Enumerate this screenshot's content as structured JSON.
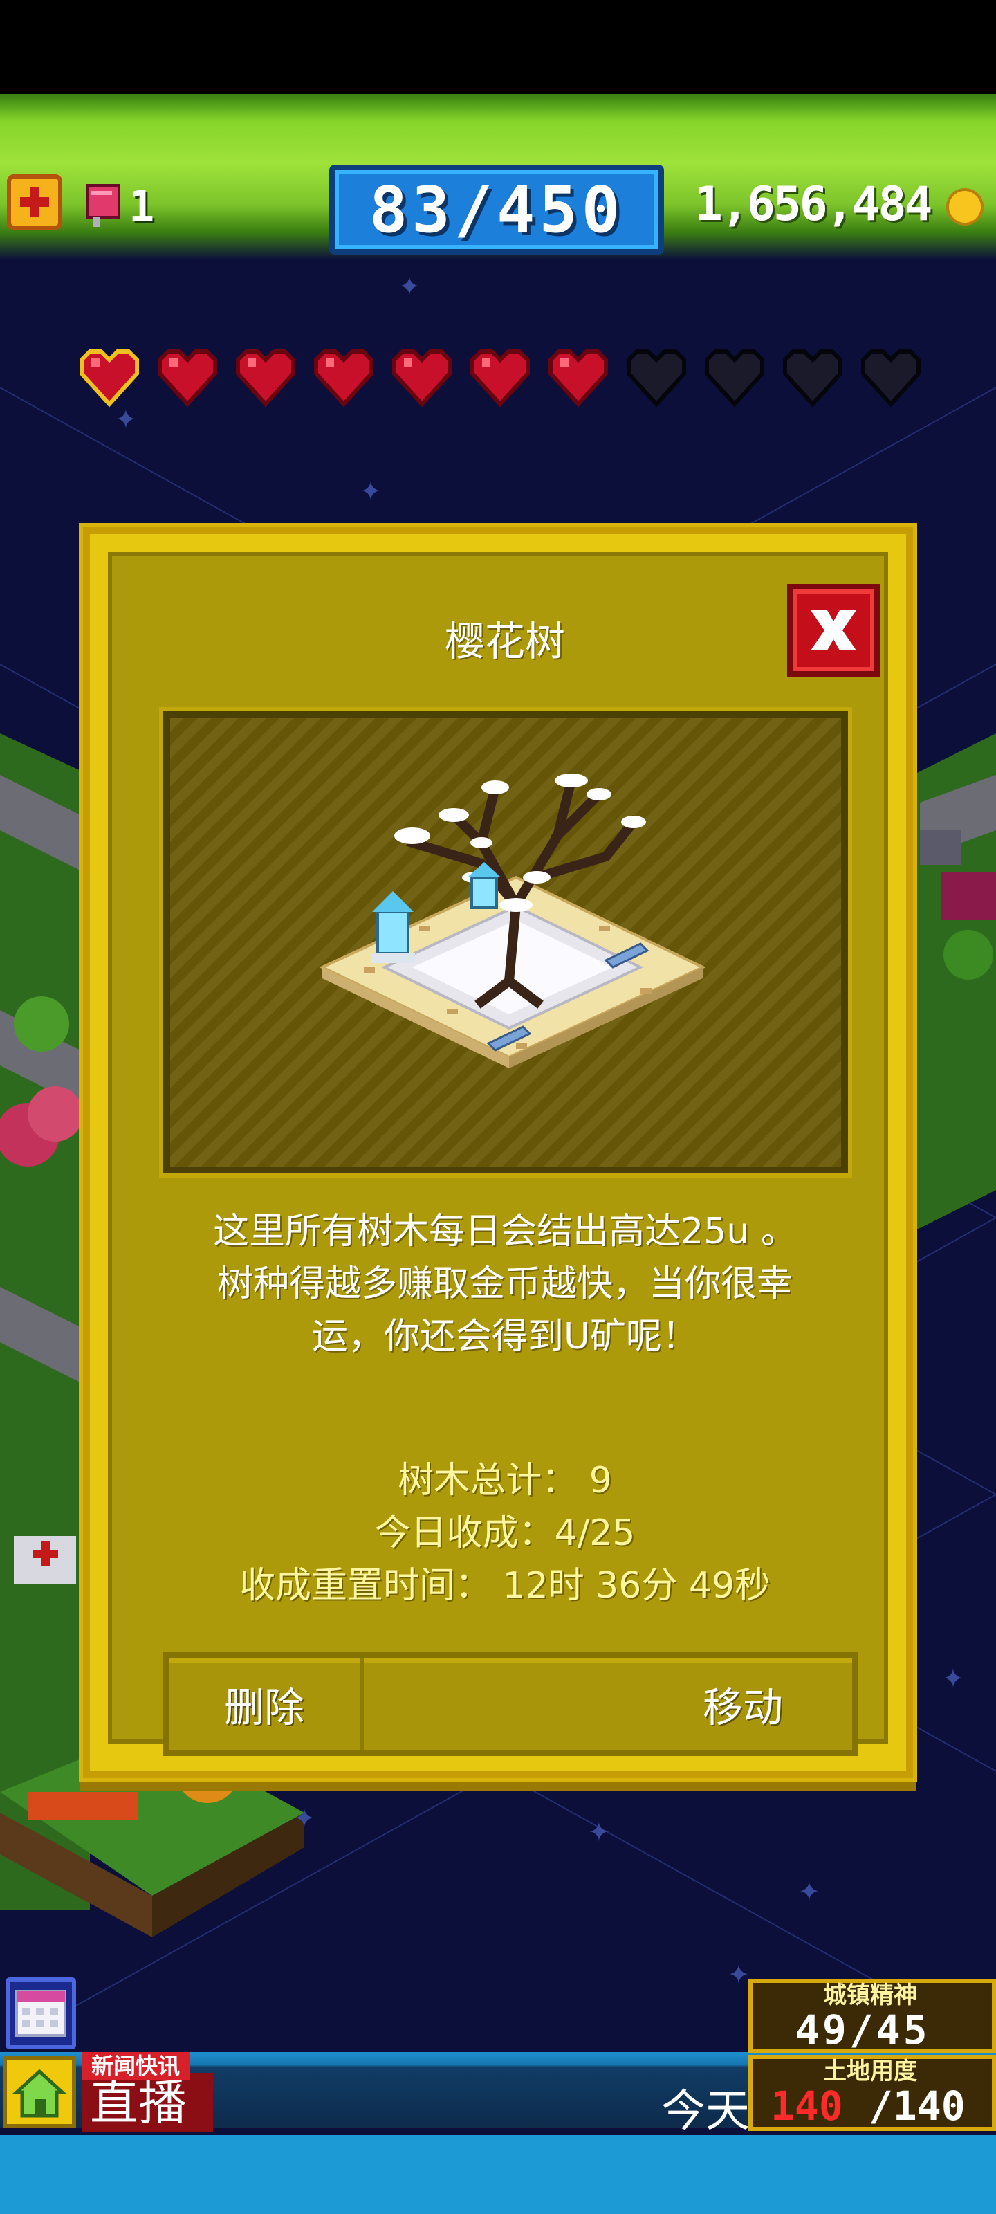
{
  "header": {
    "mail_count": "1",
    "population": "83/450",
    "coins": "1,656,484"
  },
  "hearts": {
    "filled": 7,
    "total": 11
  },
  "dialog": {
    "title": "樱花树",
    "description_lines": [
      "这里所有树木每日会结出高达25u 。",
      "树种得越多赚取金币越快，当你很幸",
      "运，你还会得到U矿呢！"
    ],
    "stats": {
      "total": "树木总计：  9",
      "harvest": "今日收成：4/25",
      "reset": "收成重置时间：  12时 36分 49秒"
    },
    "delete_label": "删除",
    "move_label": "移动"
  },
  "bottom": {
    "news_label": "新闻快讯",
    "live_label": "直播",
    "ticker": "今天",
    "civic_title": "城镇精神",
    "civic_value": "49/45",
    "land_title": "土地用度",
    "land_used": "140",
    "land_cap": "/140"
  },
  "colors": {
    "dialog_bg": "#e6c810",
    "close_red": "#c40e1a",
    "pop_blue": "#1c7fd9",
    "heart_red": "#c8102a",
    "heart_empty": "#1a1a2a"
  },
  "icons": [
    "add-icon",
    "mail-icon",
    "coin-icon",
    "heart-icon",
    "close-icon",
    "calendar-icon",
    "home-icon"
  ]
}
